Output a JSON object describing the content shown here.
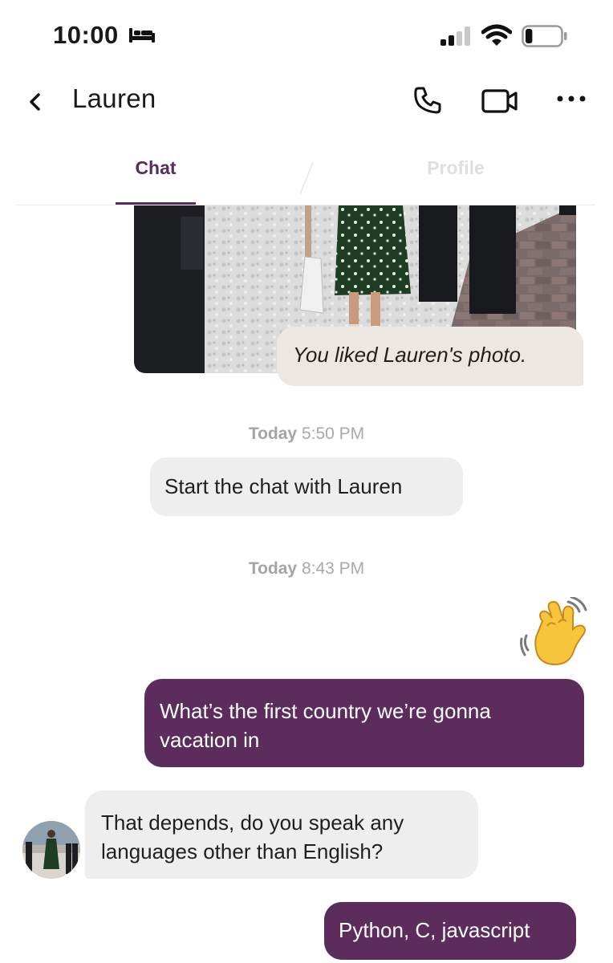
{
  "status_bar": {
    "time": "10:00",
    "sleep_icon": "bed-icon",
    "signal_icon": "cellular-signal-icon",
    "wifi_icon": "wifi-icon",
    "battery_icon": "battery-low-icon",
    "battery_level": 0.2
  },
  "header": {
    "back_icon": "chevron-left-icon",
    "contact_name": "Lauren",
    "call_icon": "phone-icon",
    "video_icon": "video-camera-icon",
    "more_icon": "more-horizontal-icon"
  },
  "tabs": {
    "chat_label": "Chat",
    "profile_label": "Profile",
    "active": "Chat"
  },
  "messages": {
    "photo_like_note": "You liked Lauren's photo.",
    "timestamp_1": {
      "day": "Today",
      "time": "5:50 PM"
    },
    "start_prompt": "Start the chat with Lauren",
    "timestamp_2": {
      "day": "Today",
      "time": "8:43 PM"
    },
    "wave_emoji": "👋",
    "sent_1": "What’s the first country we’re gonna vacation in",
    "received_1": "That depends, do you speak any languages other than English?",
    "sent_2": "Python, C, javascript"
  },
  "colors": {
    "brand_purple": "#5c2d5c",
    "tab_active": "#5b2a5e",
    "tab_inactive": "#e2dde2",
    "bubble_gray": "#eeeeee",
    "like_bubble": "#ede7e2",
    "timestamp_gray": "#a9a9a9"
  }
}
